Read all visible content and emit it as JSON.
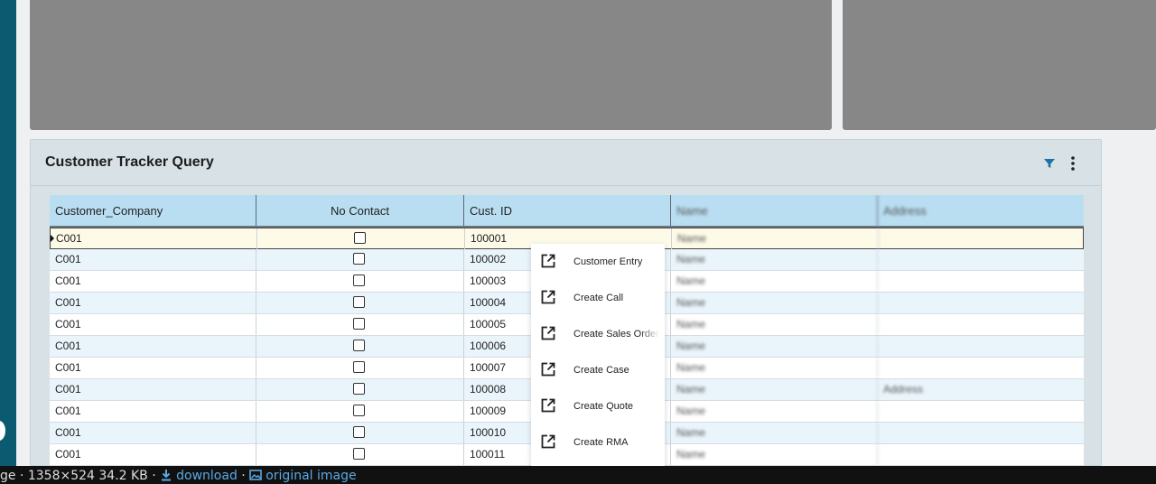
{
  "widget": {
    "title": "Customer Tracker Query",
    "filter_icon": "filter-icon",
    "menu_icon": "more-vertical-icon"
  },
  "grid": {
    "columns": [
      "Customer_Company",
      "No Contact",
      "Cust. ID",
      "Name",
      "Address"
    ],
    "rows": [
      {
        "company": "C001",
        "cust_id": "100001",
        "name": "Name",
        "address": ""
      },
      {
        "company": "C001",
        "cust_id": "100002",
        "name": "Name",
        "address": ""
      },
      {
        "company": "C001",
        "cust_id": "100003",
        "name": "Name",
        "address": ""
      },
      {
        "company": "C001",
        "cust_id": "100004",
        "name": "Name",
        "address": ""
      },
      {
        "company": "C001",
        "cust_id": "100005",
        "name": "Name",
        "address": ""
      },
      {
        "company": "C001",
        "cust_id": "100006",
        "name": "Name",
        "address": ""
      },
      {
        "company": "C001",
        "cust_id": "100007",
        "name": "Name",
        "address": ""
      },
      {
        "company": "C001",
        "cust_id": "100008",
        "name": "Name",
        "address": "Address"
      },
      {
        "company": "C001",
        "cust_id": "100009",
        "name": "Name",
        "address": ""
      },
      {
        "company": "C001",
        "cust_id": "100010",
        "name": "Name",
        "address": ""
      },
      {
        "company": "C001",
        "cust_id": "100011",
        "name": "Name",
        "address": ""
      }
    ]
  },
  "context_menu": {
    "items": [
      {
        "label": "Customer Entry",
        "icon": "open-external-icon"
      },
      {
        "label": "Create Call",
        "icon": "open-external-icon"
      },
      {
        "label": "Create Sales Order",
        "icon": "open-external-icon"
      },
      {
        "label": "Create Case",
        "icon": "open-external-icon"
      },
      {
        "label": "Create Quote",
        "icon": "open-external-icon"
      },
      {
        "label": "Create RMA",
        "icon": "open-external-icon"
      }
    ]
  },
  "status_bar": {
    "prefix": "ge · 1358×524 34.2 KB · ",
    "download": "download",
    "separator": " · ",
    "original": "original image"
  },
  "colors": {
    "rail": "#0b5a70",
    "header": "#b9def2",
    "accent_icon": "#1f6fa8"
  }
}
